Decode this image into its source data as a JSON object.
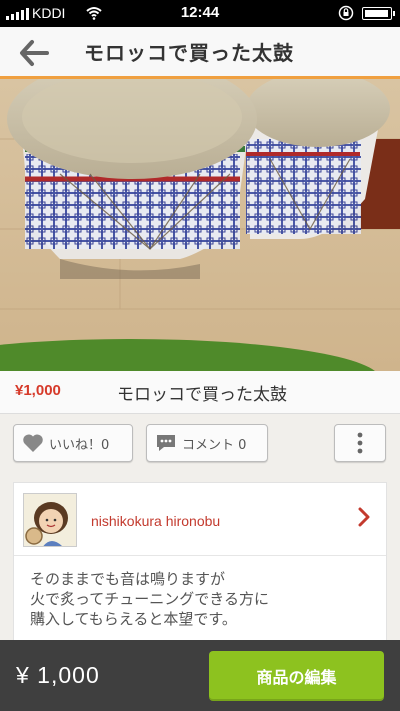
{
  "status_bar": {
    "carrier": "KDDI",
    "time": "12:44"
  },
  "header": {
    "title": "モロッコで買った太鼓",
    "back_icon": "arrow-left-icon"
  },
  "product": {
    "price": "¥1,000",
    "name": "モロッコで買った太鼓"
  },
  "actions": {
    "like_label": "いいね！0",
    "comment_label": "コメント 0",
    "more_icon": "vertical-ellipsis-icon"
  },
  "seller": {
    "name": "nishikokura hironobu",
    "description": "そのままでも音は鳴りますが\n火で炙ってチューニングできる方に\n購入してもらえると本望です。"
  },
  "bottom_bar": {
    "price": "¥ 1,000",
    "edit_label": "商品の編集"
  },
  "colors": {
    "accent_orange": "#f0a040",
    "price_red": "#d63a2a",
    "edit_green": "#8dc21f",
    "bottom_bar": "#3f3f3f"
  }
}
